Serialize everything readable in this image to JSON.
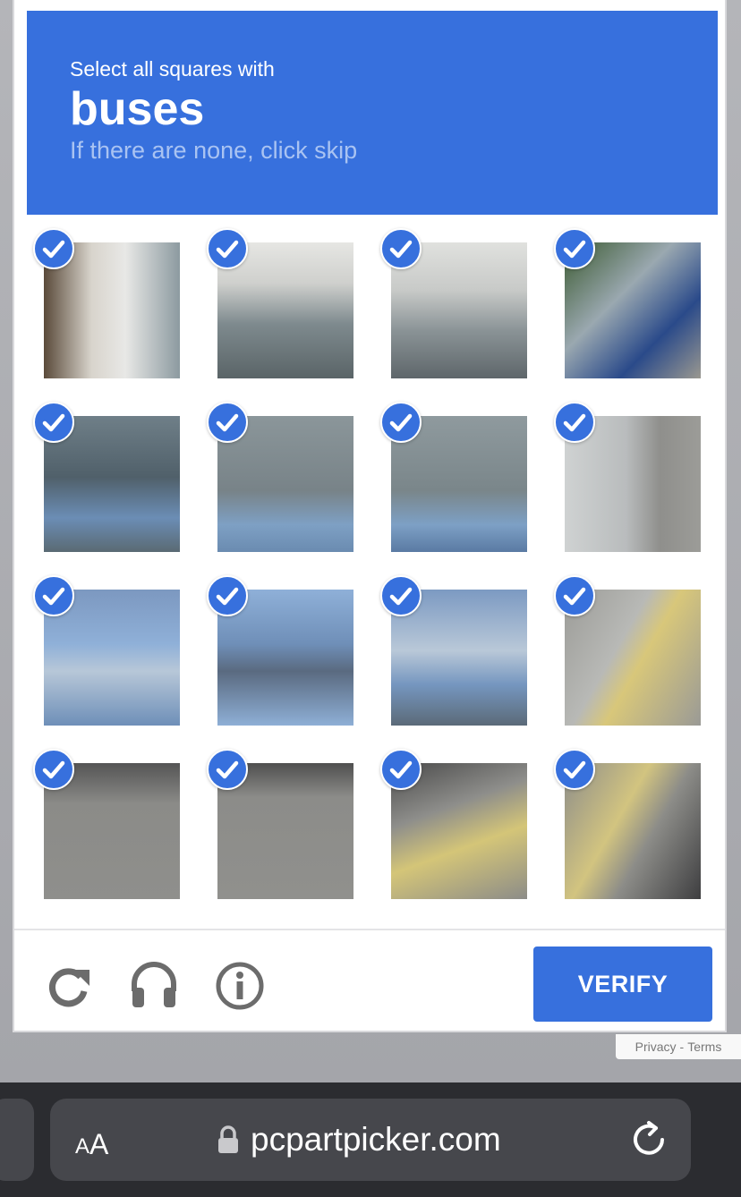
{
  "captcha": {
    "instruction": "Select all squares with",
    "keyword": "buses",
    "hint": "If there are none, click skip",
    "tiles_selected": [
      true,
      true,
      true,
      true,
      true,
      true,
      true,
      true,
      true,
      true,
      true,
      true,
      true,
      true,
      true,
      true
    ],
    "accent_color": "#3770dd"
  },
  "footer": {
    "reload_icon": "reload-icon",
    "audio_icon": "headphones-icon",
    "info_icon": "info-icon",
    "verify_label": "VERIFY"
  },
  "legal": {
    "privacy": "Privacy",
    "separator": "-",
    "terms": "Terms"
  },
  "browser": {
    "text_size_small": "A",
    "text_size_big": "A",
    "domain": "pcpartpicker.com"
  }
}
